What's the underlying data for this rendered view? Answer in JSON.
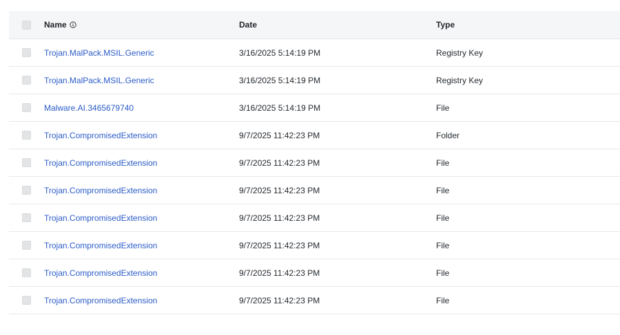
{
  "table": {
    "columns": {
      "name": "Name",
      "date": "Date",
      "type": "Type"
    },
    "rows": [
      {
        "name": "Trojan.MalPack.MSIL.Generic",
        "date": "3/16/2025 5:14:19 PM",
        "type": "Registry Key"
      },
      {
        "name": "Trojan.MalPack.MSIL.Generic",
        "date": "3/16/2025 5:14:19 PM",
        "type": "Registry Key"
      },
      {
        "name": "Malware.AI.3465679740",
        "date": "3/16/2025 5:14:19 PM",
        "type": "File"
      },
      {
        "name": "Trojan.CompromisedExtension",
        "date": "9/7/2025 11:42:23 PM",
        "type": "Folder"
      },
      {
        "name": "Trojan.CompromisedExtension",
        "date": "9/7/2025 11:42:23 PM",
        "type": "File"
      },
      {
        "name": "Trojan.CompromisedExtension",
        "date": "9/7/2025 11:42:23 PM",
        "type": "File"
      },
      {
        "name": "Trojan.CompromisedExtension",
        "date": "9/7/2025 11:42:23 PM",
        "type": "File"
      },
      {
        "name": "Trojan.CompromisedExtension",
        "date": "9/7/2025 11:42:23 PM",
        "type": "File"
      },
      {
        "name": "Trojan.CompromisedExtension",
        "date": "9/7/2025 11:42:23 PM",
        "type": "File"
      },
      {
        "name": "Trojan.CompromisedExtension",
        "date": "9/7/2025 11:42:23 PM",
        "type": "File"
      }
    ]
  },
  "icons": {
    "info": "info-circle-icon"
  },
  "colors": {
    "link": "#2a5bc7",
    "header_bg": "#f5f6f7",
    "divider": "#e6e8ea"
  }
}
